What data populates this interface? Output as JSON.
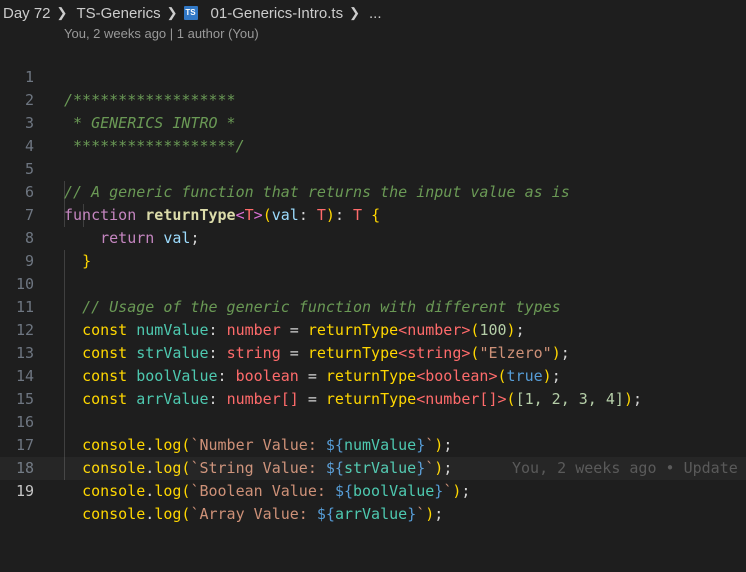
{
  "breadcrumb": {
    "items": [
      "Day 72",
      "TS-Generics",
      "01-Generics-Intro.ts",
      "..."
    ],
    "file_icon_text": "TS"
  },
  "blame": {
    "header": "You, 2 weeks ago | 1 author (You)",
    "inline": "You, 2 weeks ago • Update"
  },
  "gutter": {
    "line_numbers": [
      "1",
      "2",
      "3",
      "4",
      "5",
      "6",
      "7",
      "8",
      "9",
      "10",
      "11",
      "12",
      "13",
      "14",
      "15",
      "16",
      "17",
      "18",
      "19"
    ]
  },
  "code": {
    "l1": "/******************",
    "l2": " * GENERICS INTRO *",
    "l3": " ******************/",
    "l5_comment": "// A generic function that returns the input value as is",
    "l6_kw": "function",
    "l6_fn": "returnType",
    "l6_param": "val",
    "l6_type": "T",
    "l7_kw": "return",
    "l7_val": "val",
    "l10_comment": "// Usage of the generic function with different types",
    "decls": [
      {
        "name": "numValue",
        "type": "number",
        "arg": "100"
      },
      {
        "name": "strValue",
        "type": "string",
        "arg": "\"Elzero\""
      },
      {
        "name": "boolValue",
        "type": "boolean",
        "arg": "true"
      },
      {
        "name": "arrValue",
        "type": "number[]",
        "arg": "[1, 2, 3, 4]"
      }
    ],
    "const_kw": "const",
    "call_fn": "returnType",
    "console": "console",
    "log": "log",
    "logs": [
      {
        "label": "Number Value: ",
        "var": "numValue"
      },
      {
        "label": "String Value: ",
        "var": "strValue"
      },
      {
        "label": "Boolean Value: ",
        "var": "boolValue"
      },
      {
        "label": "Array Value: ",
        "var": "arrValue"
      }
    ]
  },
  "colors": {
    "background": "#1e1e1e",
    "comment": "#6a9955",
    "keyword": "#569cd6",
    "function": "#dcdcaa"
  }
}
